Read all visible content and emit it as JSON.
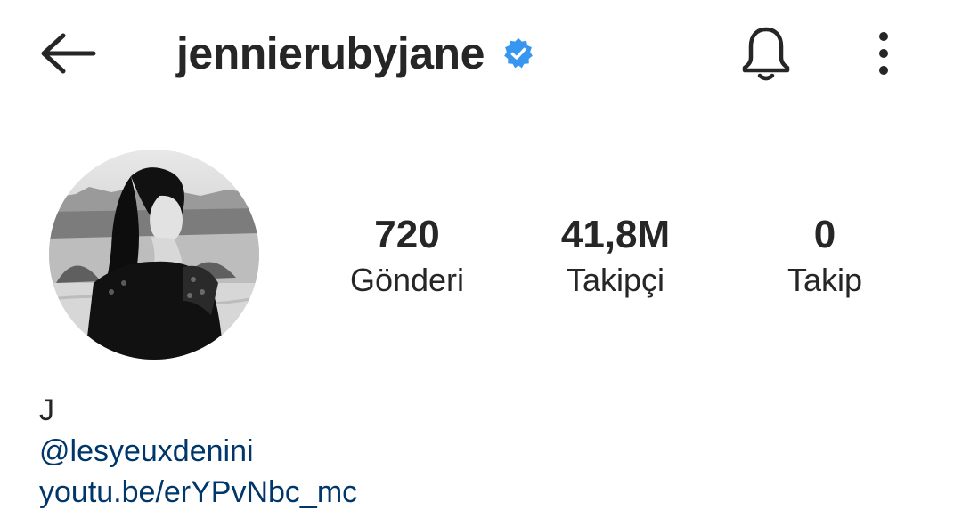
{
  "header": {
    "username": "jennierubyjane",
    "verified": true
  },
  "profile": {
    "stats": {
      "posts": {
        "value": "720",
        "label": "Gönderi"
      },
      "followers": {
        "value": "41,8M",
        "label": "Takipçi"
      },
      "following": {
        "value": "0",
        "label": "Takip"
      }
    }
  },
  "bio": {
    "name": "J",
    "mention": "@lesyeuxdenini",
    "link": "youtu.be/erYPvNbc_mc"
  },
  "colors": {
    "text": "#262626",
    "link": "#00376b",
    "verified": "#3797f0"
  },
  "icons": {
    "back": "arrow-left-icon",
    "verified": "verified-badge-icon",
    "notifications": "bell-icon",
    "more": "more-vertical-icon"
  }
}
